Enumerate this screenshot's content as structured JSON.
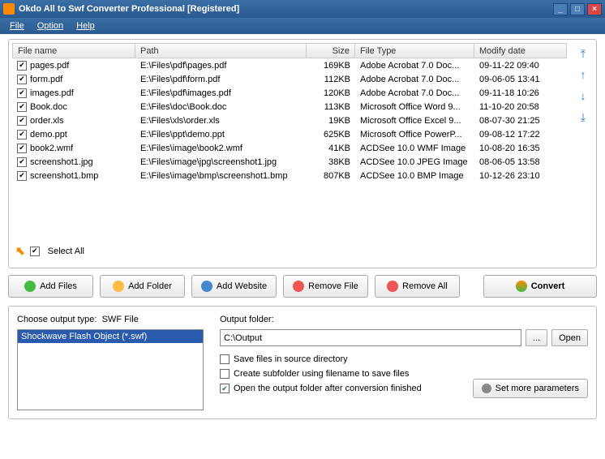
{
  "window": {
    "title": "Okdo All to Swf Converter Professional [Registered]"
  },
  "menu": {
    "file": "File",
    "option": "Option",
    "help": "Help"
  },
  "columns": {
    "name": "File name",
    "path": "Path",
    "size": "Size",
    "type": "File Type",
    "date": "Modify date"
  },
  "files": [
    {
      "name": "pages.pdf",
      "path": "E:\\Files\\pdf\\pages.pdf",
      "size": "169KB",
      "type": "Adobe Acrobat 7.0 Doc...",
      "date": "09-11-22 09:40"
    },
    {
      "name": "form.pdf",
      "path": "E:\\Files\\pdf\\form.pdf",
      "size": "112KB",
      "type": "Adobe Acrobat 7.0 Doc...",
      "date": "09-06-05 13:41"
    },
    {
      "name": "images.pdf",
      "path": "E:\\Files\\pdf\\images.pdf",
      "size": "120KB",
      "type": "Adobe Acrobat 7.0 Doc...",
      "date": "09-11-18 10:26"
    },
    {
      "name": "Book.doc",
      "path": "E:\\Files\\doc\\Book.doc",
      "size": "113KB",
      "type": "Microsoft Office Word 9...",
      "date": "11-10-20 20:58"
    },
    {
      "name": "order.xls",
      "path": "E:\\Files\\xls\\order.xls",
      "size": "19KB",
      "type": "Microsoft Office Excel 9...",
      "date": "08-07-30 21:25"
    },
    {
      "name": "demo.ppt",
      "path": "E:\\Files\\ppt\\demo.ppt",
      "size": "625KB",
      "type": "Microsoft Office PowerP...",
      "date": "09-08-12 17:22"
    },
    {
      "name": "book2.wmf",
      "path": "E:\\Files\\image\\book2.wmf",
      "size": "41KB",
      "type": "ACDSee 10.0 WMF Image",
      "date": "10-08-20 16:35"
    },
    {
      "name": "screenshot1.jpg",
      "path": "E:\\Files\\image\\jpg\\screenshot1.jpg",
      "size": "38KB",
      "type": "ACDSee 10.0 JPEG Image",
      "date": "08-06-05 13:58"
    },
    {
      "name": "screenshot1.bmp",
      "path": "E:\\Files\\image\\bmp\\screenshot1.bmp",
      "size": "807KB",
      "type": "ACDSee 10.0 BMP Image",
      "date": "10-12-26 23:10"
    }
  ],
  "selectAll": "Select All",
  "buttons": {
    "addFiles": "Add Files",
    "addFolder": "Add Folder",
    "addWebsite": "Add Website",
    "removeFile": "Remove File",
    "removeAll": "Remove All",
    "convert": "Convert"
  },
  "output": {
    "chooseTypeLabel": "Choose output type:",
    "typeValue": "SWF File",
    "typeItem": "Shockwave Flash Object (*.swf)",
    "folderLabel": "Output folder:",
    "folderValue": "C:\\Output",
    "browse": "...",
    "open": "Open",
    "saveInSource": "Save files in source directory",
    "createSubfolder": "Create subfolder using filename to save files",
    "openAfter": "Open the output folder after conversion finished",
    "moreParams": "Set more parameters"
  }
}
